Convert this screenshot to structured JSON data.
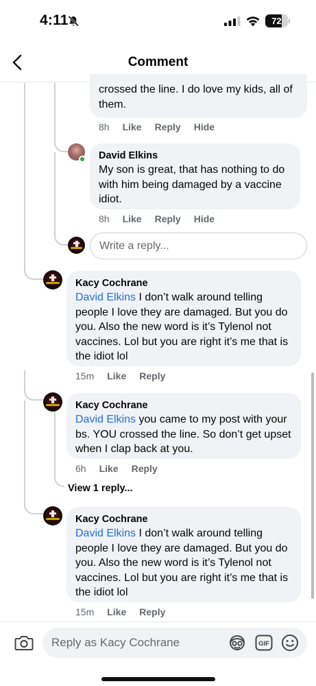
{
  "status_bar": {
    "time": "4:11",
    "battery_text": "72",
    "battery_level": 0.72,
    "icons": [
      "bell-off-icon",
      "cellular-signal-icon",
      "wifi-icon",
      "battery-icon"
    ]
  },
  "header": {
    "title": "Comment",
    "back_icon": "chevron-left-icon"
  },
  "comments": [
    {
      "id": "partial-top",
      "author": "",
      "text": "crossed the line. I do love my kids, all of them.",
      "time": "8h",
      "actions": [
        "Like",
        "Reply",
        "Hide"
      ]
    },
    {
      "id": "david-1",
      "author": "David Elkins",
      "text": "My son is great, that has nothing to do with him being damaged by a vaccine idiot.",
      "time": "8h",
      "actions": [
        "Like",
        "Reply",
        "Hide"
      ],
      "online": true
    },
    {
      "id": "kacy-1",
      "author": "Kacy Cochrane",
      "mention": "David Elkins",
      "text": " I don’t walk around telling people I love they are damaged. But you do you. Also the new word is it’s Tylenol not vaccines. Lol  but you are right it’s me that is the idiot lol",
      "time": "15m",
      "actions": [
        "Like",
        "Reply"
      ]
    },
    {
      "id": "kacy-2",
      "author": "Kacy Cochrane",
      "mention": "David Elkins",
      "text": " you came to my post with your bs. YOU crossed the line. So don’t get upset when I clap back at you.",
      "time": "6h",
      "actions": [
        "Like",
        "Reply"
      ]
    },
    {
      "id": "kacy-3",
      "author": "Kacy Cochrane",
      "mention": "David Elkins",
      "text": " I don’t walk around telling people I love they are damaged. But you do you. Also the new word is it’s Tylenol not vaccines. Lol  but you are right it’s me that is the idiot lol",
      "time": "15m",
      "actions": [
        "Like",
        "Reply"
      ]
    }
  ],
  "reply_box": {
    "placeholder": "Write a reply..."
  },
  "view_replies": "View 1 reply...",
  "composer": {
    "placeholder": "Reply as Kacy Cochrane",
    "icons": [
      "camera-icon",
      "avatar-sticker-icon",
      "gif-icon",
      "emoji-icon"
    ],
    "gif_label": "GIF"
  },
  "colors": {
    "mention": "#216fdb",
    "bubble": "#f0f2f5",
    "meta": "#65676b",
    "online": "#31a24c"
  }
}
